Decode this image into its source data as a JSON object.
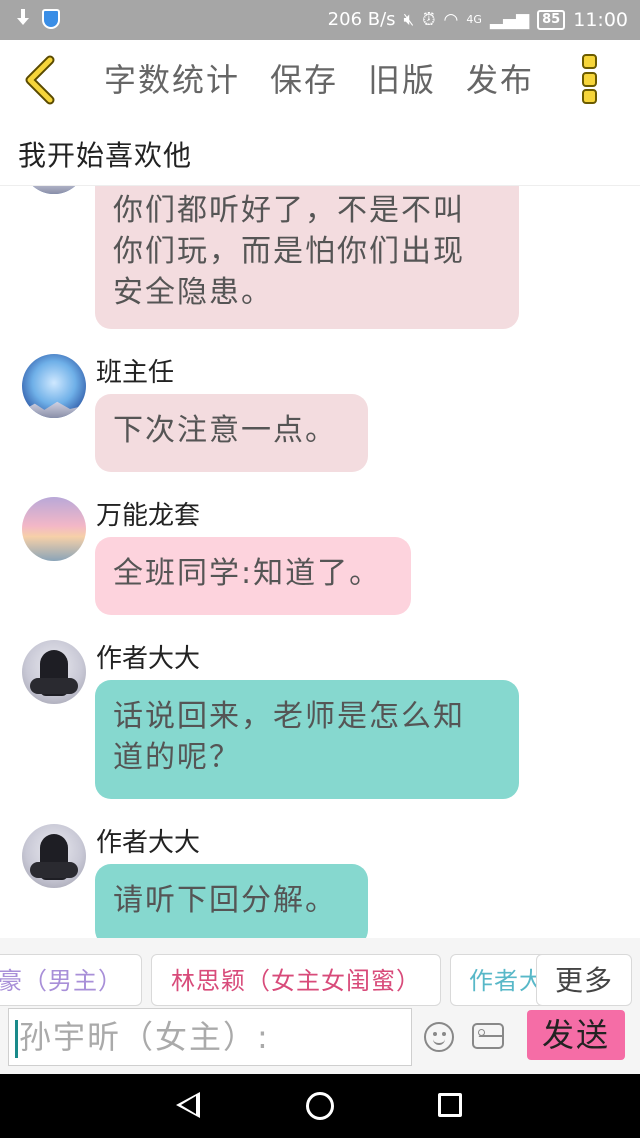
{
  "status_bar": {
    "speed": "206 B/s",
    "network": "4G",
    "battery": "85",
    "time": "11:00",
    "icons": [
      "download-icon",
      "shield-icon",
      "mute-icon",
      "alarm-icon",
      "wifi-icon",
      "signal-icon",
      "battery-icon"
    ]
  },
  "toolbar": {
    "back_icon": "chevron-left-icon",
    "items": [
      "字数统计",
      "保存",
      "旧版",
      "发布"
    ],
    "more_icon": "more-vertical-icon",
    "accent_color": "#f6d53a"
  },
  "story_title": "我开始喜欢他",
  "messages": [
    {
      "sender": "",
      "text_lines": [
        "你们都听好了，不是不叫",
        "你们玩，而是怕你们出现",
        "安全隐患。"
      ],
      "color": "#f3dcdf",
      "avatar": "landscape-avatar"
    },
    {
      "sender": "班主任",
      "text_lines": [
        "下次注意一点。"
      ],
      "color": "#f3dcdf",
      "avatar": "landscape-avatar"
    },
    {
      "sender": "万能龙套",
      "text_lines": [
        "全班同学:知道了。"
      ],
      "color": "#fdd3dd",
      "avatar": "sunset-avatar"
    },
    {
      "sender": "作者大大",
      "text_lines": [
        "话说回来，老师是怎么知",
        "道的呢？"
      ],
      "color": "#86d8cf",
      "avatar": "girl-avatar"
    },
    {
      "sender": "作者大大",
      "text_lines": [
        "请听下回分解。"
      ],
      "color": "#86d8cf",
      "avatar": "girl-avatar"
    }
  ],
  "role_chips": [
    "豪（男主）",
    "林思颖（女主女闺蜜）",
    "作者大"
  ],
  "more_label": "更多",
  "input": {
    "value": "孙宇昕（女主）:"
  },
  "send_label": "发送",
  "send_color": "#f56da6",
  "nav_icons": [
    "back-triangle-icon",
    "home-circle-icon",
    "recent-square-icon"
  ]
}
